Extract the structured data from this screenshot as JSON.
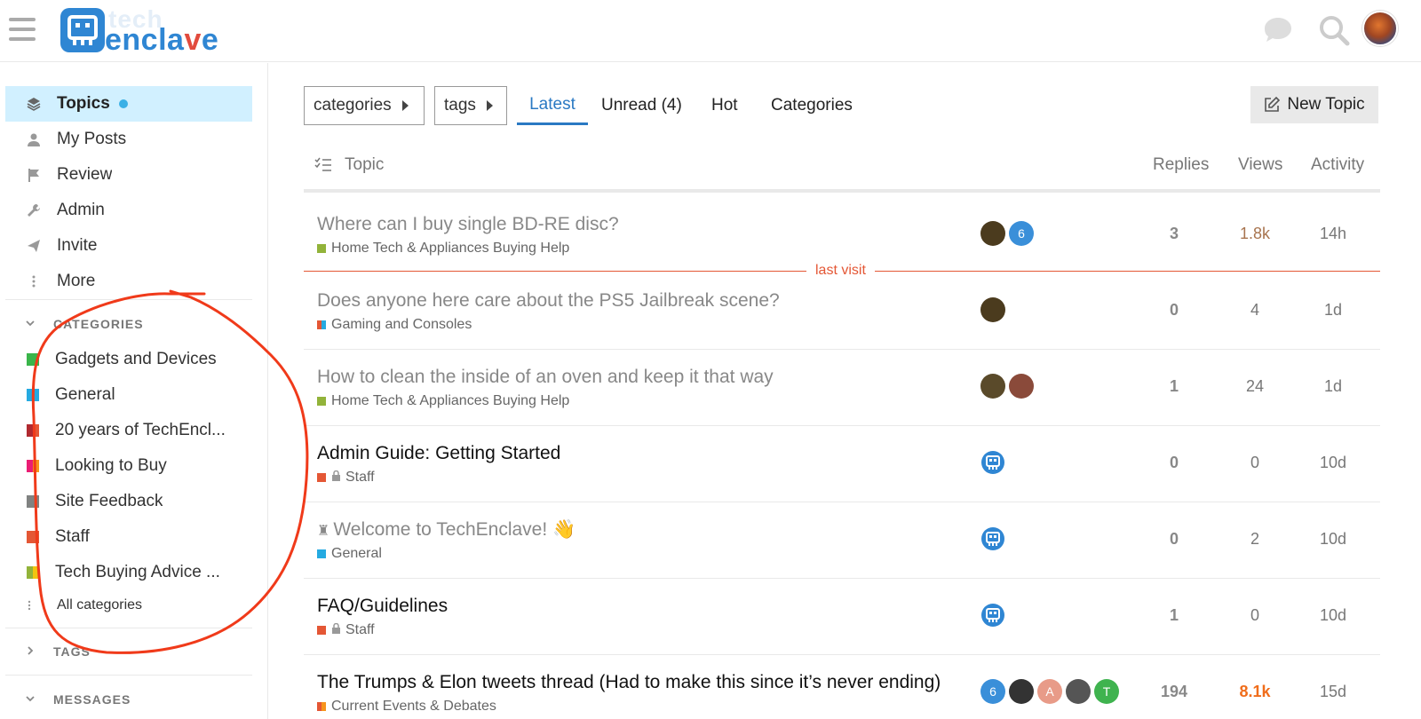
{
  "brand": {
    "word1": "tech",
    "word2a": "encla",
    "word2b": "v",
    "word2c": "e"
  },
  "sidebar": {
    "nav": [
      {
        "label": "Topics",
        "active": true
      },
      {
        "label": "My Posts"
      },
      {
        "label": "Review"
      },
      {
        "label": "Admin"
      },
      {
        "label": "Invite"
      },
      {
        "label": "More"
      }
    ],
    "categories_title": "CATEGORIES",
    "categories": [
      {
        "label": "Gadgets and Devices",
        "colors": [
          "#3ab54a"
        ]
      },
      {
        "label": "General",
        "colors": [
          "#25aae1"
        ]
      },
      {
        "label": "20 years of TechEncl...",
        "colors": [
          "#b02a30",
          "#e45735"
        ]
      },
      {
        "label": "Looking to Buy",
        "colors": [
          "#ea1d74",
          "#f7941d"
        ]
      },
      {
        "label": "Site Feedback",
        "colors": [
          "#808281"
        ]
      },
      {
        "label": "Staff",
        "colors": [
          "#e45735"
        ]
      },
      {
        "label": "Tech Buying Advice ...",
        "colors": [
          "#92b33a",
          "#f1c40f"
        ]
      }
    ],
    "all_categories": "All categories",
    "tags_title": "TAGS",
    "messages_title": "MESSAGES"
  },
  "toolbar": {
    "categories_drop": "categories",
    "tags_drop": "tags",
    "tabs": [
      "Latest",
      "Unread (4)",
      "Hot",
      "Categories"
    ],
    "new_topic": "New Topic"
  },
  "table": {
    "headers": {
      "topic": "Topic",
      "replies": "Replies",
      "views": "Views",
      "activity": "Activity"
    },
    "last_visit": "last visit",
    "rows": [
      {
        "title": "Where can I buy single BD-RE disc?",
        "unread": false,
        "category": "Home Tech & Appliances Buying Help",
        "cat_colors": [
          "#92b33a"
        ],
        "locked": false,
        "replies": "3",
        "views": "1.8k",
        "views_style": "hot1",
        "activity": "14h",
        "avatars": [
          {
            "bg": "#4b3b1e",
            "text": ""
          },
          {
            "bg": "#3a8fd9",
            "text": "6"
          }
        ]
      },
      {
        "title": "Does anyone here care about the PS5 Jailbreak scene?",
        "unread": false,
        "category": "Gaming and Consoles",
        "cat_colors": [
          "#e45735",
          "#25aae1"
        ],
        "locked": false,
        "replies": "0",
        "views": "4",
        "views_style": "",
        "activity": "1d",
        "avatars": [
          {
            "bg": "#4b3b1e",
            "text": ""
          }
        ]
      },
      {
        "title": "How to clean the inside of an oven and keep it that way",
        "unread": false,
        "category": "Home Tech & Appliances Buying Help",
        "cat_colors": [
          "#92b33a"
        ],
        "locked": false,
        "replies": "1",
        "views": "24",
        "views_style": "",
        "activity": "1d",
        "avatars": [
          {
            "bg": "#5a4a2a",
            "text": ""
          },
          {
            "bg": "#8a4a3a",
            "text": ""
          }
        ]
      },
      {
        "title": "Admin Guide: Getting Started",
        "unread": true,
        "category": "Staff",
        "cat_colors": [
          "#e45735"
        ],
        "locked": true,
        "replies": "0",
        "views": "0",
        "views_style": "",
        "activity": "10d",
        "avatars": [
          {
            "bg": "bot",
            "text": ""
          }
        ]
      },
      {
        "title": "Welcome to TechEnclave! 👋",
        "unread": false,
        "pinned": true,
        "category": "General",
        "cat_colors": [
          "#25aae1"
        ],
        "locked": false,
        "replies": "0",
        "views": "2",
        "views_style": "",
        "activity": "10d",
        "avatars": [
          {
            "bg": "bot",
            "text": ""
          }
        ]
      },
      {
        "title": "FAQ/Guidelines",
        "unread": true,
        "category": "Staff",
        "cat_colors": [
          "#e45735"
        ],
        "locked": true,
        "replies": "1",
        "views": "0",
        "views_style": "",
        "activity": "10d",
        "avatars": [
          {
            "bg": "bot",
            "text": ""
          }
        ]
      },
      {
        "title": "The Trumps & Elon tweets thread (Had to make this since it’s never ending)",
        "unread": true,
        "category": "Current Events & Debates",
        "cat_colors": [
          "#e45735",
          "#f7941d"
        ],
        "locked": false,
        "replies": "194",
        "views": "8.1k",
        "views_style": "hot2",
        "activity": "15d",
        "avatars": [
          {
            "bg": "#3a8fd9",
            "text": "6"
          },
          {
            "bg": "#333",
            "text": ""
          },
          {
            "bg": "#e89b88",
            "text": "A"
          },
          {
            "bg": "#555",
            "text": ""
          },
          {
            "bg": "#3fb34f",
            "text": "T"
          }
        ]
      }
    ]
  },
  "colors": {
    "accent": "#2a79c3",
    "active_bg": "#d1f0ff",
    "last_visit": "#e45735"
  }
}
